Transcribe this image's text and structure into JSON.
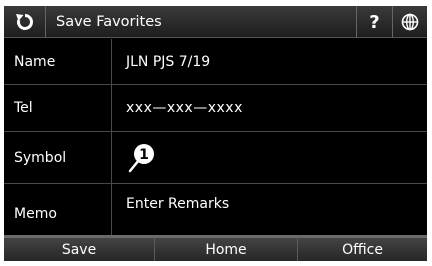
{
  "header": {
    "back_icon": "refresh-back-icon",
    "title": "Save Favorites",
    "help_label": "?",
    "globe_icon": "globe-icon"
  },
  "form": {
    "name": {
      "label": "Name",
      "value": "JLN PJS 7/19"
    },
    "tel": {
      "label": "Tel",
      "value": "xxx—xxx—xxxx"
    },
    "symbol": {
      "label": "Symbol",
      "icon": "pin-icon",
      "number": "1"
    },
    "memo": {
      "label": "Memo",
      "value": "Enter Remarks"
    }
  },
  "tabs": [
    {
      "label": "Save"
    },
    {
      "label": "Home"
    },
    {
      "label": "Office"
    }
  ],
  "colors": {
    "background": "#000000",
    "text": "#ffffff",
    "divider": "#4a4a4a"
  }
}
